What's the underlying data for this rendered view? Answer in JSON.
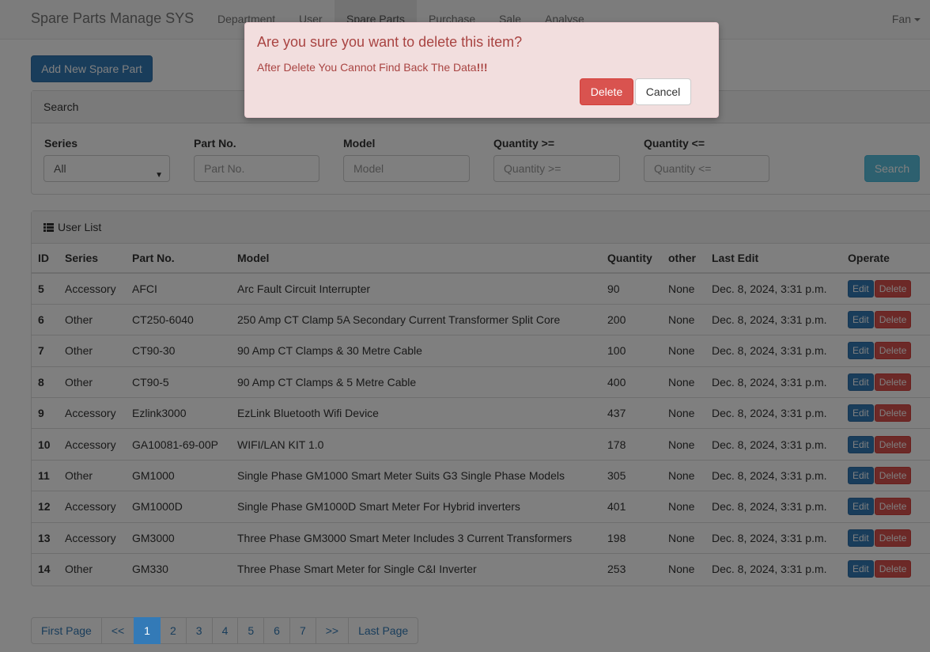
{
  "app": {
    "brand": "Spare Parts Manage SYS"
  },
  "nav": {
    "items": [
      {
        "label": "Department"
      },
      {
        "label": "User"
      },
      {
        "label": "Spare Parts"
      },
      {
        "label": "Purchase"
      },
      {
        "label": "Sale"
      },
      {
        "label": "Analyse"
      }
    ],
    "active": "Spare Parts",
    "user": "Fan"
  },
  "toolbar": {
    "add_label": "Add New Spare Part"
  },
  "search": {
    "heading": "Search",
    "series_label": "Series",
    "series_value": "All",
    "part_no_label": "Part No.",
    "part_no_placeholder": "Part No.",
    "model_label": "Model",
    "model_placeholder": "Model",
    "qty_gte_label": "Quantity >=",
    "qty_gte_placeholder": "Quantity >=",
    "qty_lte_label": "Quantity <=",
    "qty_lte_placeholder": "Quantity <=",
    "search_button": "Search"
  },
  "list": {
    "heading": "User List",
    "columns": [
      "ID",
      "Series",
      "Part No.",
      "Model",
      "Quantity",
      "other",
      "Last Edit",
      "Operate"
    ],
    "edit_label": "Edit",
    "delete_label": "Delete",
    "rows": [
      {
        "id": "5",
        "series": "Accessory",
        "part_no": "AFCI",
        "model": "Arc Fault Circuit Interrupter",
        "quantity": "90",
        "other": "None",
        "last_edit": "Dec. 8, 2024, 3:31 p.m."
      },
      {
        "id": "6",
        "series": "Other",
        "part_no": "CT250-6040",
        "model": "250 Amp CT Clamp 5A Secondary Current Transformer Split Core",
        "quantity": "200",
        "other": "None",
        "last_edit": "Dec. 8, 2024, 3:31 p.m."
      },
      {
        "id": "7",
        "series": "Other",
        "part_no": "CT90-30",
        "model": "90 Amp CT Clamps & 30 Metre Cable",
        "quantity": "100",
        "other": "None",
        "last_edit": "Dec. 8, 2024, 3:31 p.m."
      },
      {
        "id": "8",
        "series": "Other",
        "part_no": "CT90-5",
        "model": "90 Amp CT Clamps & 5 Metre Cable",
        "quantity": "400",
        "other": "None",
        "last_edit": "Dec. 8, 2024, 3:31 p.m."
      },
      {
        "id": "9",
        "series": "Accessory",
        "part_no": "Ezlink3000",
        "model": "EzLink Bluetooth Wifi Device",
        "quantity": "437",
        "other": "None",
        "last_edit": "Dec. 8, 2024, 3:31 p.m."
      },
      {
        "id": "10",
        "series": "Accessory",
        "part_no": "GA10081-69-00P",
        "model": "WIFI/LAN KIT 1.0",
        "quantity": "178",
        "other": "None",
        "last_edit": "Dec. 8, 2024, 3:31 p.m."
      },
      {
        "id": "11",
        "series": "Other",
        "part_no": "GM1000",
        "model": "Single Phase GM1000 Smart Meter Suits G3 Single Phase Models",
        "quantity": "305",
        "other": "None",
        "last_edit": "Dec. 8, 2024, 3:31 p.m."
      },
      {
        "id": "12",
        "series": "Accessory",
        "part_no": "GM1000D",
        "model": "Single Phase GM1000D Smart Meter For Hybrid inverters",
        "quantity": "401",
        "other": "None",
        "last_edit": "Dec. 8, 2024, 3:31 p.m."
      },
      {
        "id": "13",
        "series": "Accessory",
        "part_no": "GM3000",
        "model": "Three Phase GM3000 Smart Meter Includes 3 Current Transformers",
        "quantity": "198",
        "other": "None",
        "last_edit": "Dec. 8, 2024, 3:31 p.m."
      },
      {
        "id": "14",
        "series": "Other",
        "part_no": "GM330",
        "model": "Three Phase Smart Meter for Single C&I Inverter",
        "quantity": "253",
        "other": "None",
        "last_edit": "Dec. 8, 2024, 3:31 p.m."
      }
    ]
  },
  "pagination": {
    "first": "First Page",
    "prev": "<<",
    "pages": [
      "1",
      "2",
      "3",
      "4",
      "5",
      "6",
      "7"
    ],
    "current": "1",
    "next": ">>",
    "last": "Last Page"
  },
  "modal": {
    "title": "Are you sure you want to delete this item?",
    "message": "After Delete You Cannot Find Back The Data",
    "emphasis": "!!!",
    "delete_button": "Delete",
    "cancel_button": "Cancel"
  },
  "colors": {
    "primary": "#337ab7",
    "danger": "#d9534f",
    "info": "#5bc0de",
    "modal_bg": "#f2dede",
    "modal_text": "#a94442"
  }
}
